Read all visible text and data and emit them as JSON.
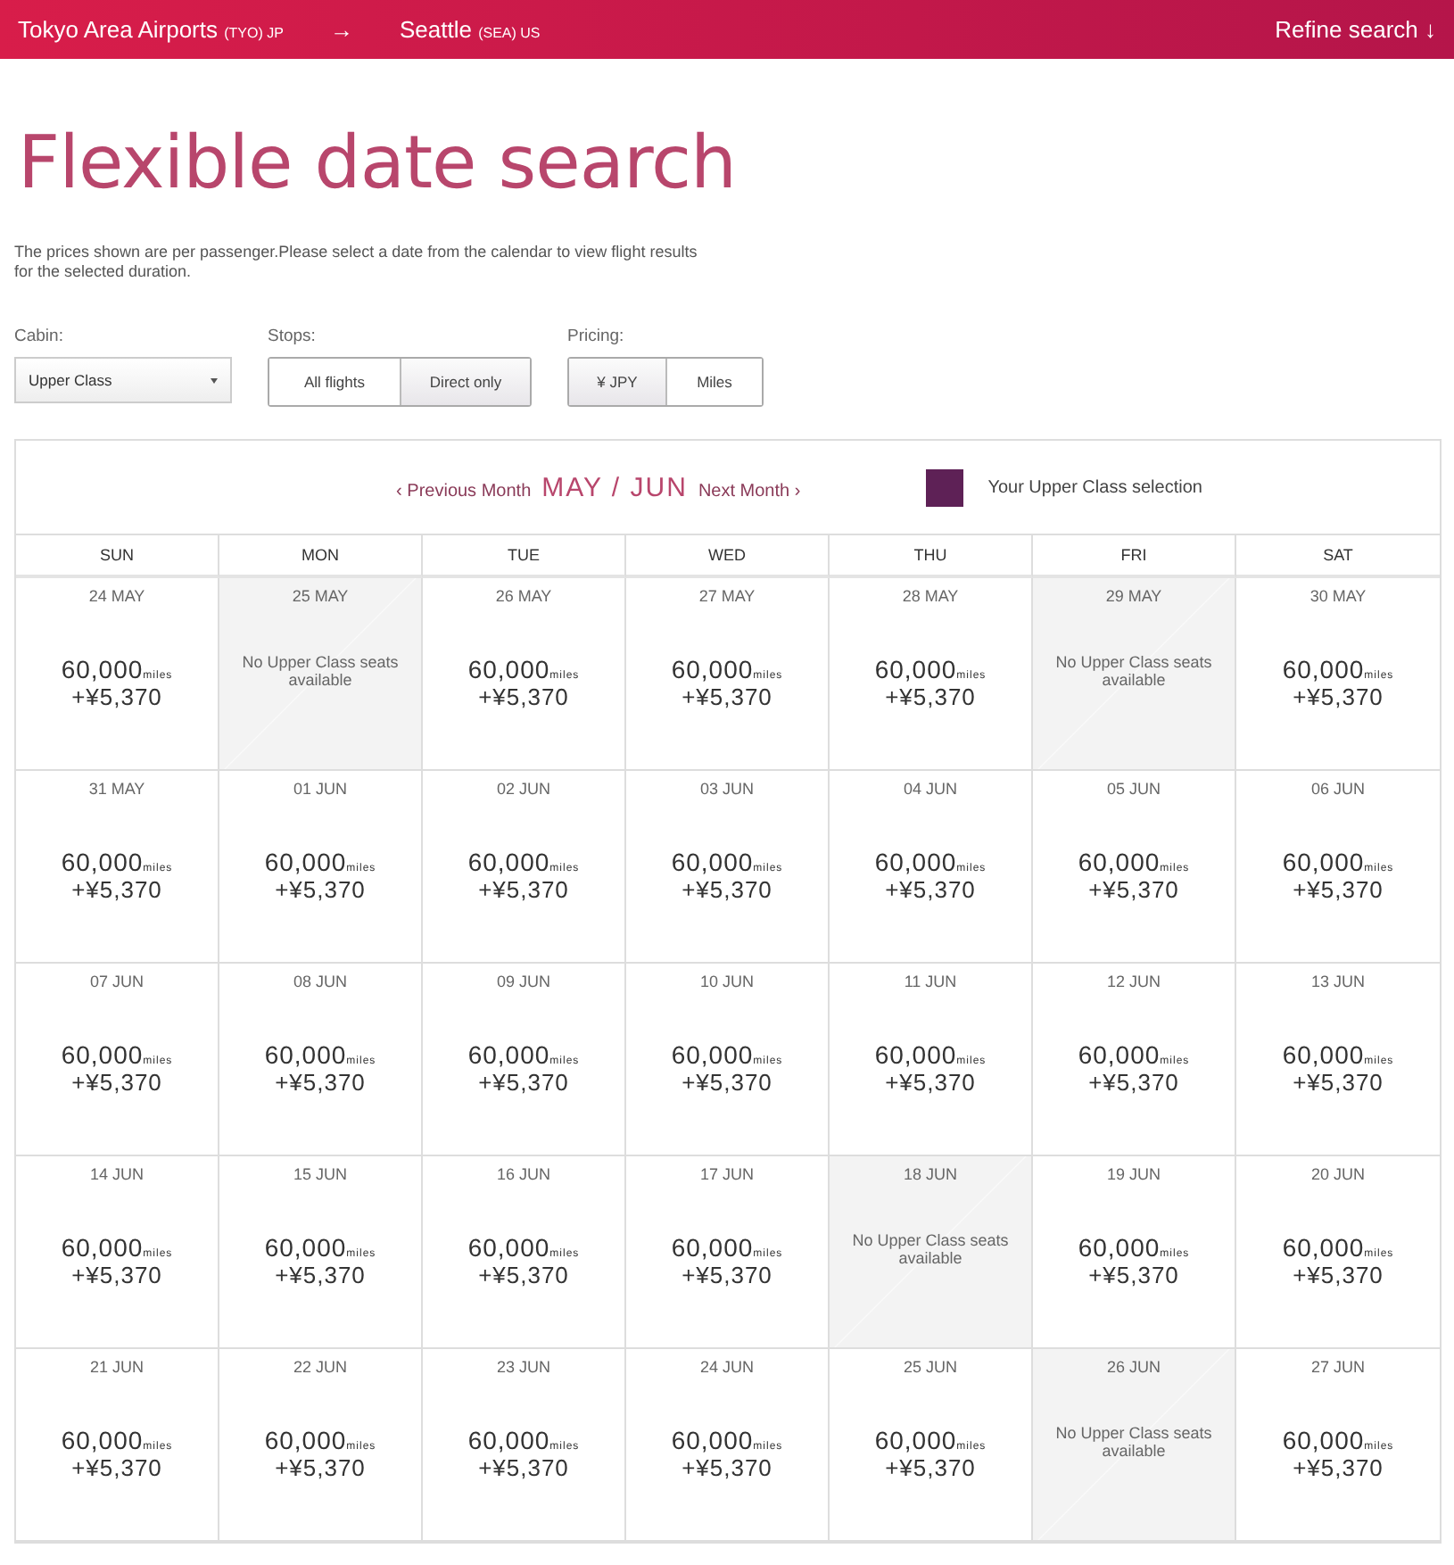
{
  "route": {
    "origin": "Tokyo Area Airports",
    "origin_code": "(TYO) JP",
    "arrow": "→",
    "destination": "Seattle",
    "destination_code": "(SEA) US",
    "refine": "Refine search",
    "refine_arrow": "↓"
  },
  "title": "Flexible date search",
  "intro": "The prices shown are per passenger.Please select a date from the calendar to view flight results for the selected duration.",
  "cabin": {
    "label": "Cabin:",
    "value": "Upper Class"
  },
  "stops": {
    "label": "Stops:",
    "options": [
      {
        "label": "All flights",
        "selected": false
      },
      {
        "label": "Direct only",
        "selected": true
      }
    ]
  },
  "pricing": {
    "label": "Pricing:",
    "options": [
      {
        "label": "¥ JPY",
        "selected": true
      },
      {
        "label": "Miles",
        "selected": false
      }
    ]
  },
  "calendar": {
    "previous": "Previous Month",
    "previous_icon": "‹",
    "month": "MAY / JUN",
    "next": "Next Month",
    "next_icon": "›",
    "legend": {
      "label": "Your Upper Class selection",
      "color": "#5e2156"
    },
    "weekdays": [
      "SUN",
      "MON",
      "TUE",
      "WED",
      "THU",
      "FRI",
      "SAT"
    ],
    "weeks": [
      [
        {
          "date": "24 MAY",
          "kind": "fare",
          "miles": "60,000",
          "unit": "miles",
          "tax": "+¥5,370"
        },
        {
          "date": "25 MAY",
          "kind": "unavailable",
          "note": "No Upper Class seats available"
        },
        {
          "date": "26 MAY",
          "kind": "fare",
          "miles": "60,000",
          "unit": "miles",
          "tax": "+¥5,370"
        },
        {
          "date": "27 MAY",
          "kind": "fare",
          "miles": "60,000",
          "unit": "miles",
          "tax": "+¥5,370"
        },
        {
          "date": "28 MAY",
          "kind": "fare",
          "miles": "60,000",
          "unit": "miles",
          "tax": "+¥5,370"
        },
        {
          "date": "29 MAY",
          "kind": "unavailable",
          "note": "No Upper Class seats available"
        },
        {
          "date": "30 MAY",
          "kind": "fare",
          "miles": "60,000",
          "unit": "miles",
          "tax": "+¥5,370"
        }
      ],
      [
        {
          "date": "31 MAY",
          "kind": "fare",
          "miles": "60,000",
          "unit": "miles",
          "tax": "+¥5,370"
        },
        {
          "date": "01 JUN",
          "kind": "fare",
          "miles": "60,000",
          "unit": "miles",
          "tax": "+¥5,370"
        },
        {
          "date": "02 JUN",
          "kind": "fare",
          "miles": "60,000",
          "unit": "miles",
          "tax": "+¥5,370"
        },
        {
          "date": "03 JUN",
          "kind": "fare",
          "miles": "60,000",
          "unit": "miles",
          "tax": "+¥5,370"
        },
        {
          "date": "04 JUN",
          "kind": "fare",
          "miles": "60,000",
          "unit": "miles",
          "tax": "+¥5,370"
        },
        {
          "date": "05 JUN",
          "kind": "fare",
          "miles": "60,000",
          "unit": "miles",
          "tax": "+¥5,370"
        },
        {
          "date": "06 JUN",
          "kind": "fare",
          "miles": "60,000",
          "unit": "miles",
          "tax": "+¥5,370"
        }
      ],
      [
        {
          "date": "07 JUN",
          "kind": "fare",
          "miles": "60,000",
          "unit": "miles",
          "tax": "+¥5,370"
        },
        {
          "date": "08 JUN",
          "kind": "fare",
          "miles": "60,000",
          "unit": "miles",
          "tax": "+¥5,370"
        },
        {
          "date": "09 JUN",
          "kind": "fare",
          "miles": "60,000",
          "unit": "miles",
          "tax": "+¥5,370"
        },
        {
          "date": "10 JUN",
          "kind": "fare",
          "miles": "60,000",
          "unit": "miles",
          "tax": "+¥5,370"
        },
        {
          "date": "11 JUN",
          "kind": "fare",
          "miles": "60,000",
          "unit": "miles",
          "tax": "+¥5,370"
        },
        {
          "date": "12 JUN",
          "kind": "fare",
          "miles": "60,000",
          "unit": "miles",
          "tax": "+¥5,370"
        },
        {
          "date": "13 JUN",
          "kind": "fare",
          "miles": "60,000",
          "unit": "miles",
          "tax": "+¥5,370"
        }
      ],
      [
        {
          "date": "14 JUN",
          "kind": "fare",
          "miles": "60,000",
          "unit": "miles",
          "tax": "+¥5,370"
        },
        {
          "date": "15 JUN",
          "kind": "fare",
          "miles": "60,000",
          "unit": "miles",
          "tax": "+¥5,370"
        },
        {
          "date": "16 JUN",
          "kind": "fare",
          "miles": "60,000",
          "unit": "miles",
          "tax": "+¥5,370"
        },
        {
          "date": "17 JUN",
          "kind": "fare",
          "miles": "60,000",
          "unit": "miles",
          "tax": "+¥5,370"
        },
        {
          "date": "18 JUN",
          "kind": "unavailable",
          "note": "No Upper Class seats available"
        },
        {
          "date": "19 JUN",
          "kind": "fare",
          "miles": "60,000",
          "unit": "miles",
          "tax": "+¥5,370"
        },
        {
          "date": "20 JUN",
          "kind": "fare",
          "miles": "60,000",
          "unit": "miles",
          "tax": "+¥5,370"
        }
      ],
      [
        {
          "date": "21 JUN",
          "kind": "fare",
          "miles": "60,000",
          "unit": "miles",
          "tax": "+¥5,370"
        },
        {
          "date": "22 JUN",
          "kind": "fare",
          "miles": "60,000",
          "unit": "miles",
          "tax": "+¥5,370"
        },
        {
          "date": "23 JUN",
          "kind": "fare",
          "miles": "60,000",
          "unit": "miles",
          "tax": "+¥5,370"
        },
        {
          "date": "24 JUN",
          "kind": "fare",
          "miles": "60,000",
          "unit": "miles",
          "tax": "+¥5,370"
        },
        {
          "date": "25 JUN",
          "kind": "fare",
          "miles": "60,000",
          "unit": "miles",
          "tax": "+¥5,370"
        },
        {
          "date": "26 JUN",
          "kind": "unavailable",
          "note": "No Upper Class seats available"
        },
        {
          "date": "27 JUN",
          "kind": "fare",
          "miles": "60,000",
          "unit": "miles",
          "tax": "+¥5,370"
        }
      ]
    ]
  }
}
